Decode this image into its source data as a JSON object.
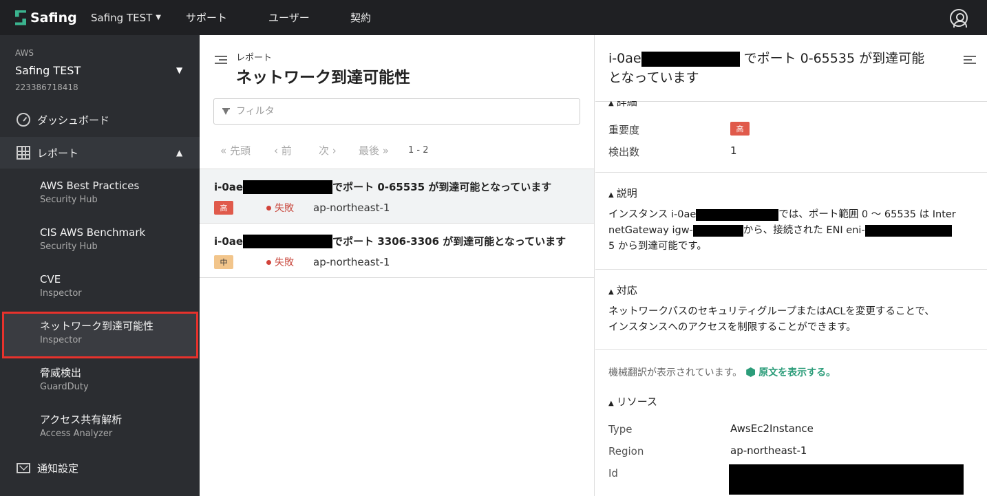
{
  "topbar": {
    "logo_text": "Safing",
    "tenant": "Safing TEST",
    "nav": [
      "サポート",
      "ユーザー",
      "契約"
    ],
    "icons": [
      "chevron-down-icon",
      "user-circle-icon"
    ]
  },
  "sidebar": {
    "account": {
      "provider": "AWS",
      "name": "Safing TEST",
      "id": "223386718418"
    },
    "dashboard": "ダッシュボード",
    "reports": "レポート",
    "items": [
      {
        "title": "AWS Best Practices",
        "sub": "Security Hub"
      },
      {
        "title": "CIS AWS Benchmark",
        "sub": "Security Hub"
      },
      {
        "title": "CVE",
        "sub": "Inspector"
      },
      {
        "title": "ネットワーク到達可能性",
        "sub": "Inspector"
      },
      {
        "title": "脅威検出",
        "sub": "GuardDuty"
      },
      {
        "title": "アクセス共有解析",
        "sub": "Access Analyzer"
      }
    ],
    "notifications": "通知設定",
    "active_index": 3,
    "colors": {
      "background": "#2b2d31",
      "active_outline": "#e8322c"
    }
  },
  "list": {
    "breadcrumb": "レポート",
    "title": "ネットワーク到達可能性",
    "filter_placeholder": "フィルタ",
    "pager": {
      "first": "« 先頭",
      "prev": "‹ 前",
      "next": "次 ›",
      "last": "最後 »",
      "range": "1 - 2"
    },
    "results": [
      {
        "prefix": "i-0ae",
        "suffix": "でポート 0-65535 が到達可能となっています",
        "severity": "高",
        "status": "失敗",
        "region": "ap-northeast-1"
      },
      {
        "prefix": "i-0ae",
        "suffix": "でポート 3306-3306 が到達可能となっています",
        "severity": "中",
        "status": "失敗",
        "region": "ap-northeast-1"
      }
    ]
  },
  "detail": {
    "title_prefix": "i-0ae",
    "title_suffix": "でポート 0-65535 が到達可能",
    "title_line2": "となっています",
    "section_details": "詳細",
    "severity_label": "重要度",
    "severity_value": "高",
    "count_label": "検出数",
    "count_value": "1",
    "section_description": "説明",
    "desc_part1": "インスタンス i-0ae",
    "desc_part2": "では、ポート範囲 0 〜 65535 は Inter",
    "desc_line2_a": "netGateway igw-",
    "desc_line2_b": "から、接続された ENI eni-",
    "desc_line3": "5 から到達可能です。",
    "section_response": "対応",
    "resp_line1": "ネットワークパスのセキュリティグループまたはACLを変更することで、",
    "resp_line2": "インスタンスへのアクセスを制限することができます。",
    "mt_note": "機械翻訳が表示されています。",
    "mt_link": "原文を表示する。",
    "section_resources": "リソース",
    "resources": [
      {
        "key": "Type",
        "value": "AwsEc2Instance"
      },
      {
        "key": "Region",
        "value": "ap-northeast-1"
      },
      {
        "key": "Id",
        "value": ""
      }
    ]
  }
}
